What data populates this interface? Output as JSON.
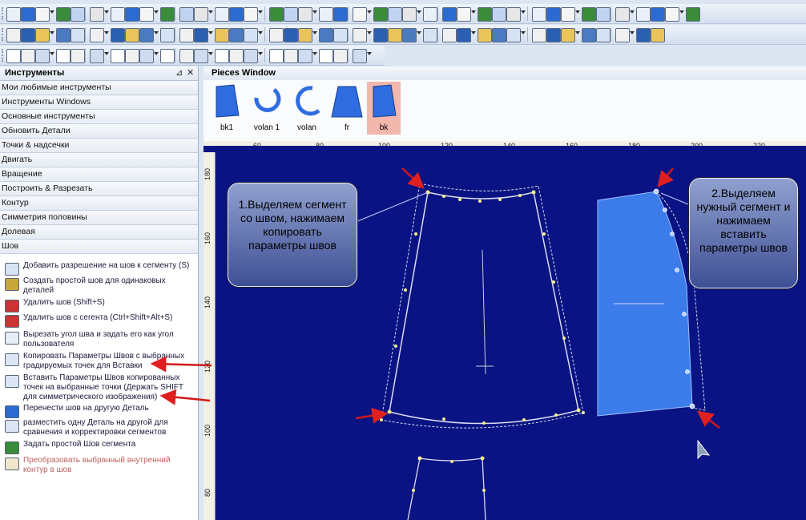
{
  "panel": {
    "title": "Инструменты",
    "pin": "⊿",
    "close": "✕",
    "categories": [
      "Мои любимые инструменты",
      "Инструменты Windows",
      "Основные инструменты",
      "Обновить Детали",
      "Точки & надсечки",
      "Двигать",
      "Вращение",
      "Построить & Разрезать",
      "Контур",
      "Симметрия половины",
      "Долевая",
      "Шов"
    ],
    "tools": [
      "Добавить разрешение на шов к сегменту (S)",
      "Создать простой шов для одинаковых деталей",
      "Удалить шов (Shift+S)",
      "Удалить шов с сегента (Ctrl+Shift+Alt+S)",
      "Вырезать угол шва и задать его как угол пользователя",
      "Копировать Параметры Швов с выбранных градируемых точек для Вставки",
      "Вставить Параметры Швов копированных точек  на выбранные точки (Держать SHIFT для симметрического изображения)",
      "Перенести шов на другую Деталь",
      "разместить одну Деталь на другой для сравнения и корректировки сегментов",
      "Задать простой Шов сегмента",
      "Преобразовать выбранный внутренний контур в шов"
    ]
  },
  "pieces_window": {
    "title": "Pieces Window",
    "pieces": [
      {
        "label": "bk1",
        "icon": "skirt-panel-icon"
      },
      {
        "label": "volan 1",
        "icon": "ring-icon"
      },
      {
        "label": "volan",
        "icon": "arc-icon"
      },
      {
        "label": "fr",
        "icon": "skirt-front-icon"
      },
      {
        "label": "bk",
        "icon": "skirt-panel-icon"
      }
    ]
  },
  "ruler": {
    "h_ticks": [
      "60",
      "80",
      "100",
      "120",
      "140",
      "160",
      "180",
      "200",
      "220"
    ],
    "v_ticks": [
      "180",
      "160",
      "140",
      "120",
      "100",
      "80"
    ]
  },
  "callouts": {
    "left": "1.Выделяем сегмент со швом, нажимаем копировать параметры швов",
    "right": "2.Выделяем нужный сегмент и нажимаем вставить параметры швов"
  },
  "colors": {
    "canvas_bg": "#0a1383",
    "piece_fill": "#3b7bea",
    "arrow": "#d01818",
    "selected_piece_bg": "#f2b7ad"
  }
}
